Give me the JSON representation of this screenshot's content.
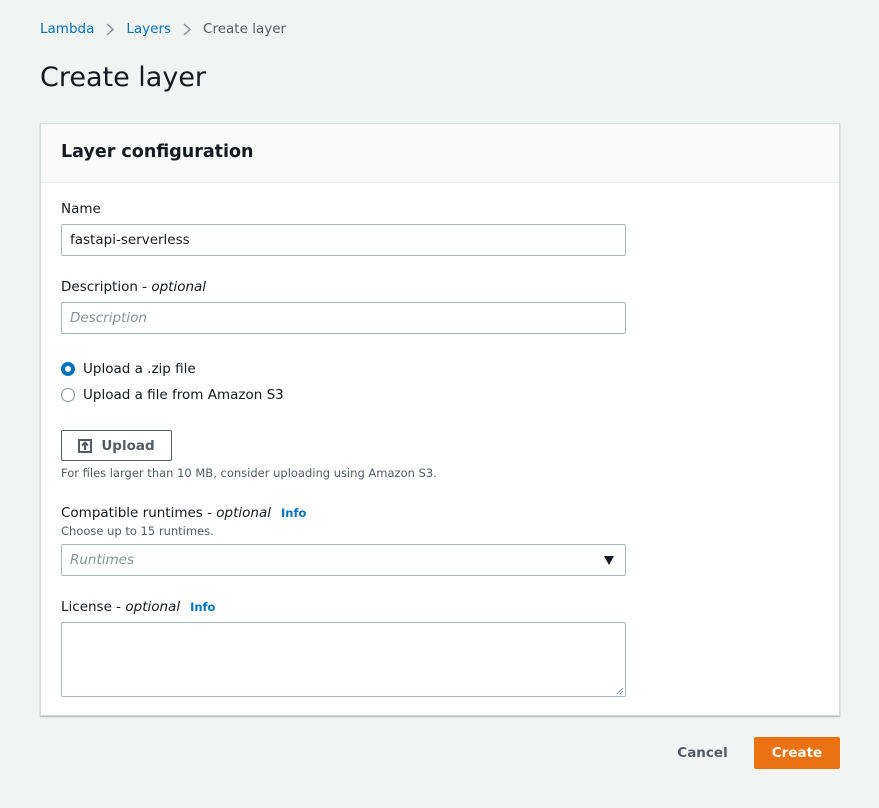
{
  "breadcrumb": {
    "items": [
      {
        "label": "Lambda"
      },
      {
        "label": "Layers"
      },
      {
        "label": "Create layer"
      }
    ]
  },
  "page": {
    "title": "Create layer"
  },
  "panel": {
    "title": "Layer configuration",
    "name": {
      "label": "Name",
      "value": "fastapi-serverless"
    },
    "description": {
      "label": "Description - ",
      "optional": "optional",
      "placeholder": "Description"
    },
    "upload_options": [
      {
        "label": "Upload a .zip file",
        "selected": true
      },
      {
        "label": "Upload a file from Amazon S3",
        "selected": false
      }
    ],
    "upload_button": {
      "label": "Upload",
      "icon": "upload-icon"
    },
    "upload_hint": "For files larger than 10 MB, consider uploading using Amazon S3.",
    "runtimes": {
      "label": "Compatible runtimes - ",
      "optional": "optional",
      "info": "Info",
      "hint": "Choose up to 15 runtimes.",
      "placeholder": "Runtimes"
    },
    "license": {
      "label": "License - ",
      "optional": "optional",
      "info": "Info",
      "value": ""
    }
  },
  "actions": {
    "cancel": "Cancel",
    "create": "Create"
  },
  "colors": {
    "link": "#0073bb",
    "primary": "#ec7211",
    "background": "#f2f3f3",
    "border": "#aab7b8"
  }
}
